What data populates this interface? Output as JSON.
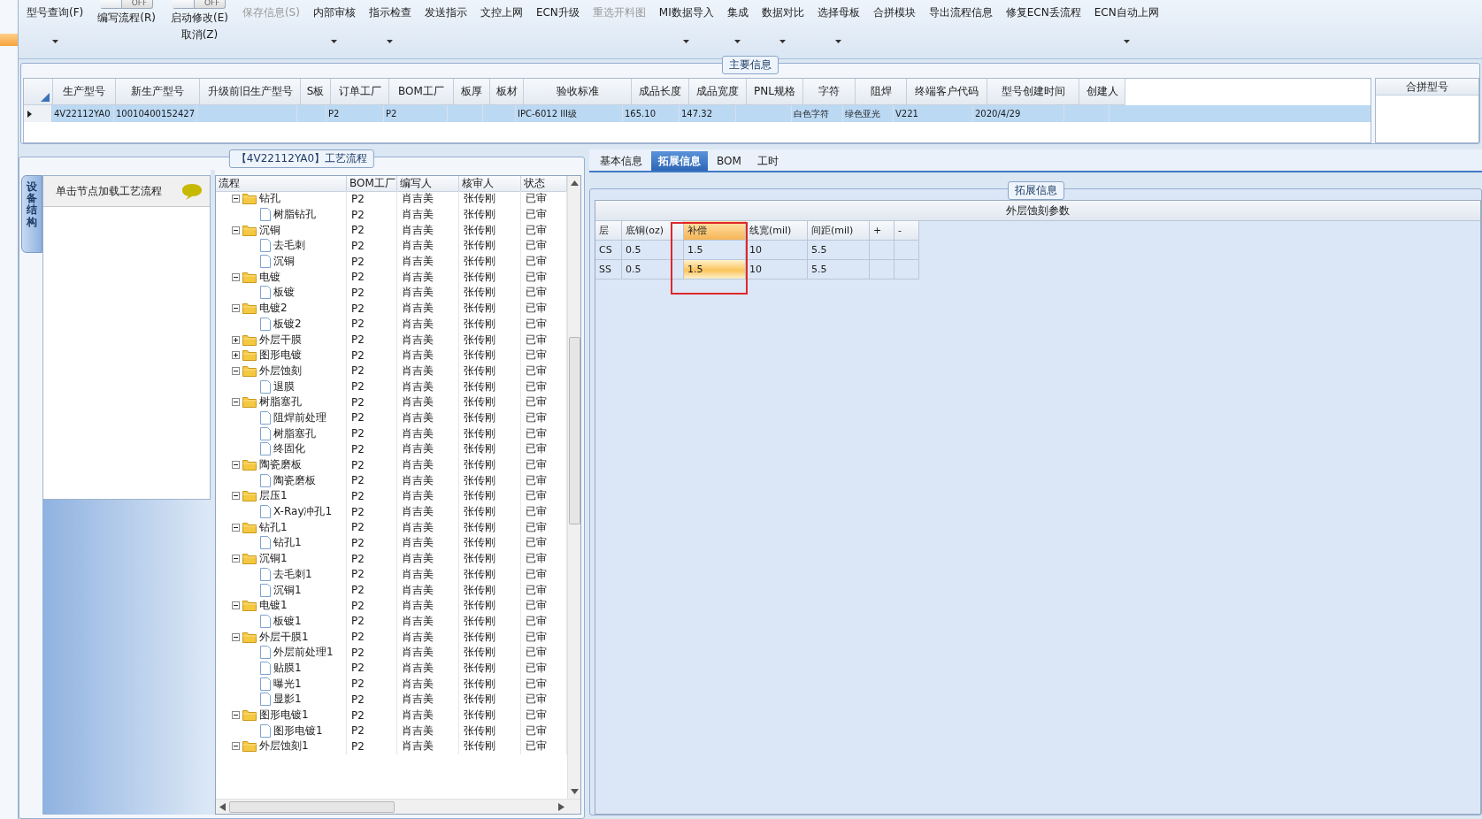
{
  "toolbar": [
    {
      "kind": "button",
      "label": "型号查询(F)",
      "disabled": false,
      "dropdown": true
    },
    {
      "kind": "toggle",
      "switch_text": "OFF",
      "on": false,
      "label": "编写流程(R)"
    },
    {
      "kind": "toggle",
      "switch_text": "OFF",
      "on": false,
      "label": "启动修改(E)",
      "sublabel": "取消(Z)"
    },
    {
      "kind": "button",
      "label": "保存信息(S)",
      "disabled": true,
      "dropdown": false
    },
    {
      "kind": "button",
      "label": "内部审核",
      "disabled": false,
      "dropdown": true
    },
    {
      "kind": "button",
      "label": "指示检查",
      "disabled": false,
      "dropdown": true
    },
    {
      "kind": "button",
      "label": "发送指示",
      "disabled": false,
      "dropdown": false
    },
    {
      "kind": "button",
      "label": "文控上网",
      "disabled": false,
      "dropdown": false
    },
    {
      "kind": "button",
      "label": "ECN升级",
      "disabled": false,
      "dropdown": false
    },
    {
      "kind": "button",
      "label": "重选开料图",
      "disabled": true,
      "dropdown": false
    },
    {
      "kind": "button",
      "label": "MI数据导入",
      "disabled": false,
      "dropdown": true
    },
    {
      "kind": "button",
      "label": "集成",
      "disabled": false,
      "dropdown": true
    },
    {
      "kind": "button",
      "label": "数据对比",
      "disabled": false,
      "dropdown": true
    },
    {
      "kind": "button",
      "label": "选择母板",
      "disabled": false,
      "dropdown": true
    },
    {
      "kind": "button",
      "label": "合拼模块",
      "disabled": false,
      "dropdown": false
    },
    {
      "kind": "button",
      "label": "导出流程信息",
      "disabled": false,
      "dropdown": false
    },
    {
      "kind": "button",
      "label": "修复ECN丢流程",
      "disabled": false,
      "dropdown": false
    },
    {
      "kind": "button",
      "label": "ECN自动上网",
      "disabled": false,
      "dropdown": true
    }
  ],
  "main_info": {
    "title": "主要信息",
    "row_selected": true,
    "columns": [
      {
        "header": "生产型号",
        "cell": "4V22112YA0"
      },
      {
        "header": "新生产型号",
        "cell": "10010400152427"
      },
      {
        "header": "升级前旧生产型号"
      },
      {
        "header": "S板"
      },
      {
        "header": "订单工厂",
        "cell": "P2"
      },
      {
        "header": "BOM工厂",
        "cell": "P2"
      },
      {
        "header": "板厚"
      },
      {
        "header": "板材"
      },
      {
        "header": "验收标准",
        "cell": "IPC-6012 III级"
      },
      {
        "header": "成品长度",
        "cell": "165.10"
      },
      {
        "header": "成品宽度",
        "cell": "147.32"
      },
      {
        "header": "PNL规格"
      },
      {
        "header": "字符",
        "cell": "白色字符"
      },
      {
        "header": "阻焊",
        "cell": "绿色亚光"
      },
      {
        "header": "终端客户代码",
        "cell": "V221"
      },
      {
        "header": "型号创建时间",
        "cell": "2020/4/29"
      },
      {
        "header": "创建人"
      }
    ],
    "side_header": "合拼型号"
  },
  "process": {
    "title": "【4V22112YA0】工艺流程",
    "side_tab": "设备结构",
    "node_hint": "单击节点加载工艺流程",
    "columns": [
      "流程",
      "BOM工厂",
      "编写人",
      "核审人",
      "状态"
    ],
    "tree": [
      {
        "kind": "folder",
        "name": "钻孔",
        "bom": "P2",
        "writer": "肖吉美",
        "reviewer": "张传刚",
        "status": "已审",
        "expanded": true,
        "children": [
          {
            "kind": "file",
            "name": "树脂钻孔",
            "bom": "P2",
            "writer": "肖吉美",
            "reviewer": "张传刚",
            "status": "已审"
          }
        ]
      },
      {
        "kind": "folder",
        "name": "沉铜",
        "bom": "P2",
        "writer": "肖吉美",
        "reviewer": "张传刚",
        "status": "已审",
        "expanded": true,
        "children": [
          {
            "kind": "file",
            "name": "去毛刺",
            "bom": "P2",
            "writer": "肖吉美",
            "reviewer": "张传刚",
            "status": "已审"
          },
          {
            "kind": "file",
            "name": "沉铜",
            "bom": "P2",
            "writer": "肖吉美",
            "reviewer": "张传刚",
            "status": "已审"
          }
        ]
      },
      {
        "kind": "folder",
        "name": "电镀",
        "bom": "P2",
        "writer": "肖吉美",
        "reviewer": "张传刚",
        "status": "已审",
        "expanded": true,
        "children": [
          {
            "kind": "file",
            "name": "板镀",
            "bom": "P2",
            "writer": "肖吉美",
            "reviewer": "张传刚",
            "status": "已审"
          }
        ]
      },
      {
        "kind": "folder",
        "name": "电镀2",
        "bom": "P2",
        "writer": "肖吉美",
        "reviewer": "张传刚",
        "status": "已审",
        "expanded": true,
        "children": [
          {
            "kind": "file",
            "name": "板镀2",
            "bom": "P2",
            "writer": "肖吉美",
            "reviewer": "张传刚",
            "status": "已审"
          }
        ]
      },
      {
        "kind": "folder",
        "name": "外层干膜",
        "bom": "P2",
        "writer": "肖吉美",
        "reviewer": "张传刚",
        "status": "已审",
        "expanded": false
      },
      {
        "kind": "folder",
        "name": "图形电镀",
        "bom": "P2",
        "writer": "肖吉美",
        "reviewer": "张传刚",
        "status": "已审",
        "expanded": false
      },
      {
        "kind": "folder",
        "name": "外层蚀刻",
        "bom": "P2",
        "writer": "肖吉美",
        "reviewer": "张传刚",
        "status": "已审",
        "expanded": true,
        "children": [
          {
            "kind": "file",
            "name": "退膜",
            "bom": "P2",
            "writer": "肖吉美",
            "reviewer": "张传刚",
            "status": "已审"
          }
        ]
      },
      {
        "kind": "folder",
        "name": "树脂塞孔",
        "bom": "P2",
        "writer": "肖吉美",
        "reviewer": "张传刚",
        "status": "已审",
        "expanded": true,
        "children": [
          {
            "kind": "file",
            "name": "阻焊前处理",
            "bom": "P2",
            "writer": "肖吉美",
            "reviewer": "张传刚",
            "status": "已审"
          },
          {
            "kind": "file",
            "name": "树脂塞孔",
            "bom": "P2",
            "writer": "肖吉美",
            "reviewer": "张传刚",
            "status": "已审"
          },
          {
            "kind": "file",
            "name": "终固化",
            "bom": "P2",
            "writer": "肖吉美",
            "reviewer": "张传刚",
            "status": "已审"
          }
        ]
      },
      {
        "kind": "folder",
        "name": "陶瓷磨板",
        "bom": "P2",
        "writer": "肖吉美",
        "reviewer": "张传刚",
        "status": "已审",
        "expanded": true,
        "children": [
          {
            "kind": "file",
            "name": "陶瓷磨板",
            "bom": "P2",
            "writer": "肖吉美",
            "reviewer": "张传刚",
            "status": "已审"
          }
        ]
      },
      {
        "kind": "folder",
        "name": "层压1",
        "bom": "P2",
        "writer": "肖吉美",
        "reviewer": "张传刚",
        "status": "已审",
        "expanded": true,
        "children": [
          {
            "kind": "file",
            "name": "X-Ray冲孔1",
            "bom": "P2",
            "writer": "肖吉美",
            "reviewer": "张传刚",
            "status": "已审"
          }
        ]
      },
      {
        "kind": "folder",
        "name": "钻孔1",
        "bom": "P2",
        "writer": "肖吉美",
        "reviewer": "张传刚",
        "status": "已审",
        "expanded": true,
        "children": [
          {
            "kind": "file",
            "name": "钻孔1",
            "bom": "P2",
            "writer": "肖吉美",
            "reviewer": "张传刚",
            "status": "已审"
          }
        ]
      },
      {
        "kind": "folder",
        "name": "沉铜1",
        "bom": "P2",
        "writer": "肖吉美",
        "reviewer": "张传刚",
        "status": "已审",
        "expanded": true,
        "children": [
          {
            "kind": "file",
            "name": "去毛刺1",
            "bom": "P2",
            "writer": "肖吉美",
            "reviewer": "张传刚",
            "status": "已审"
          },
          {
            "kind": "file",
            "name": "沉铜1",
            "bom": "P2",
            "writer": "肖吉美",
            "reviewer": "张传刚",
            "status": "已审"
          }
        ]
      },
      {
        "kind": "folder",
        "name": "电镀1",
        "bom": "P2",
        "writer": "肖吉美",
        "reviewer": "张传刚",
        "status": "已审",
        "expanded": true,
        "children": [
          {
            "kind": "file",
            "name": "板镀1",
            "bom": "P2",
            "writer": "肖吉美",
            "reviewer": "张传刚",
            "status": "已审"
          }
        ]
      },
      {
        "kind": "folder",
        "name": "外层干膜1",
        "bom": "P2",
        "writer": "肖吉美",
        "reviewer": "张传刚",
        "status": "已审",
        "expanded": true,
        "children": [
          {
            "kind": "file",
            "name": "外层前处理1",
            "bom": "P2",
            "writer": "肖吉美",
            "reviewer": "张传刚",
            "status": "已审"
          },
          {
            "kind": "file",
            "name": "贴膜1",
            "bom": "P2",
            "writer": "肖吉美",
            "reviewer": "张传刚",
            "status": "已审"
          },
          {
            "kind": "file",
            "name": "曝光1",
            "bom": "P2",
            "writer": "肖吉美",
            "reviewer": "张传刚",
            "status": "已审"
          },
          {
            "kind": "file",
            "name": "显影1",
            "bom": "P2",
            "writer": "肖吉美",
            "reviewer": "张传刚",
            "status": "已审"
          }
        ]
      },
      {
        "kind": "folder",
        "name": "图形电镀1",
        "bom": "P2",
        "writer": "肖吉美",
        "reviewer": "张传刚",
        "status": "已审",
        "expanded": true,
        "children": [
          {
            "kind": "file",
            "name": "图形电镀1",
            "bom": "P2",
            "writer": "肖吉美",
            "reviewer": "张传刚",
            "status": "已审"
          }
        ]
      },
      {
        "kind": "folder",
        "name": "外层蚀刻1",
        "bom": "P2",
        "writer": "肖吉美",
        "reviewer": "张传刚",
        "status": "已审",
        "expanded": true
      }
    ]
  },
  "detail": {
    "tabs": [
      {
        "label": "基本信息",
        "selected": false
      },
      {
        "label": "拓展信息",
        "selected": true
      },
      {
        "label": "BOM",
        "selected": false
      },
      {
        "label": "工时",
        "selected": false
      }
    ],
    "group_title": "拓展信息",
    "table_title": "外层蚀刻参数",
    "columns": [
      {
        "label": "层",
        "selected": false,
        "annotated": false
      },
      {
        "label": "底铜(oz)",
        "selected": false,
        "annotated": false
      },
      {
        "label": "补偿",
        "selected": true,
        "annotated": true
      },
      {
        "label": "线宽(mil)",
        "selected": false,
        "annotated": false
      },
      {
        "label": "间距(mil)",
        "selected": false,
        "annotated": false
      },
      {
        "label": "+",
        "selected": false,
        "annotated": false
      },
      {
        "label": "-",
        "selected": false,
        "annotated": false
      }
    ],
    "rows": [
      {
        "cells": [
          "CS",
          "0.5",
          "1.5",
          "10",
          "5.5"
        ],
        "active": false
      },
      {
        "cells": [
          "SS",
          "0.5",
          "1.5",
          "10",
          "5.5"
        ],
        "active": true
      }
    ]
  }
}
